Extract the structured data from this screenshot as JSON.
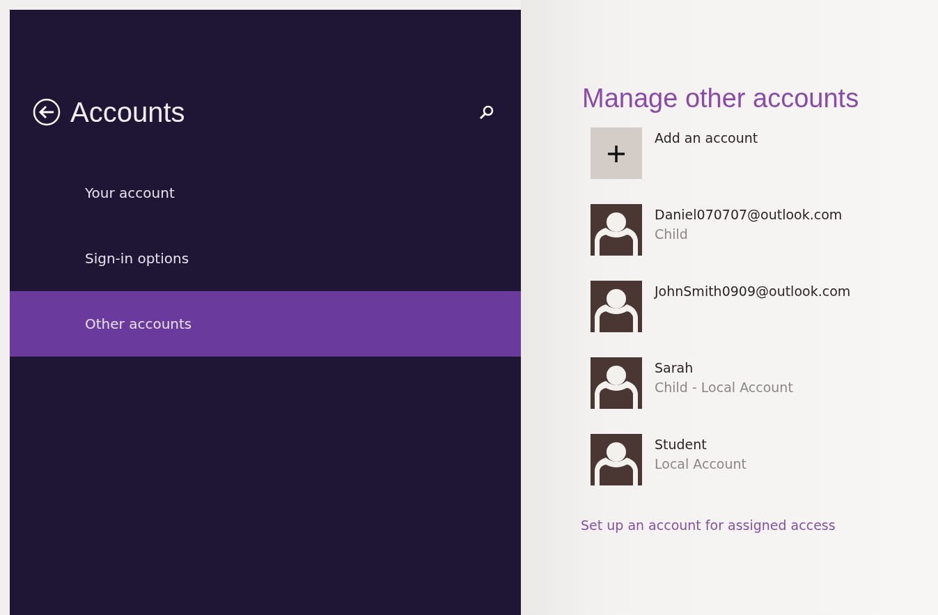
{
  "sidebar": {
    "title": "Accounts",
    "items": [
      {
        "label": "Your account",
        "selected": false
      },
      {
        "label": "Sign-in options",
        "selected": false
      },
      {
        "label": "Other accounts",
        "selected": true
      }
    ]
  },
  "main": {
    "heading": "Manage other accounts",
    "accounts": [
      {
        "kind": "add",
        "name": "Add an account"
      },
      {
        "kind": "user",
        "name": "Daniel070707@outlook.com",
        "detail": "Child"
      },
      {
        "kind": "user",
        "name": "JohnSmith0909@outlook.com"
      },
      {
        "kind": "user",
        "name": "Sarah",
        "detail": "Child - Local Account"
      },
      {
        "kind": "user",
        "name": "Student",
        "detail": "Local Account"
      }
    ],
    "link": "Set up an account for assigned access"
  }
}
